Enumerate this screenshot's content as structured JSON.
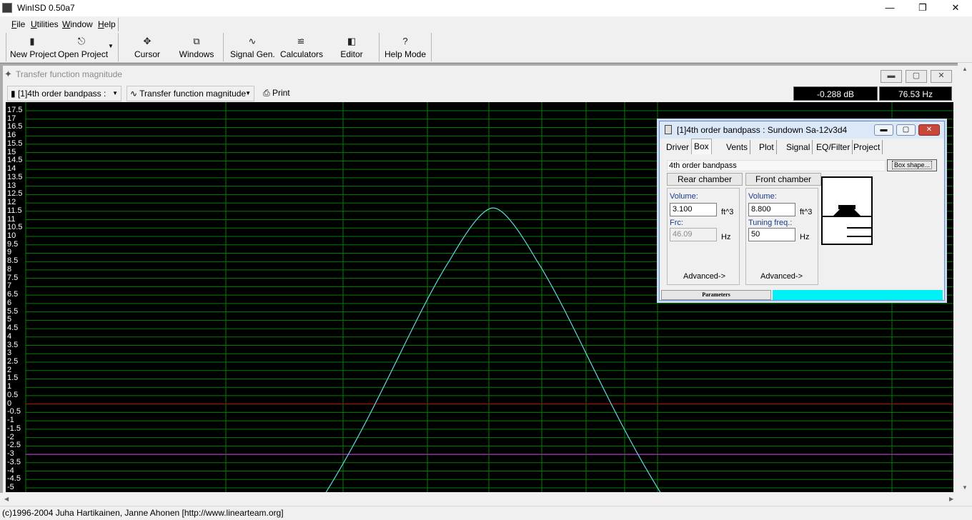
{
  "window": {
    "title": "WinISD 0.50a7"
  },
  "menu": [
    "File",
    "Utilities",
    "Window",
    "Help"
  ],
  "toolbar": {
    "new_project": "New Project",
    "open_project": "Open Project",
    "cursor": "Cursor",
    "windows": "Windows",
    "signal_gen": "Signal Gen.",
    "calculators": "Calculators",
    "editor": "Editor",
    "help_mode": "Help Mode"
  },
  "plot_window": {
    "title": "Transfer function magnitude",
    "project_selector": "[1]4th order bandpass :",
    "plot_selector": "Transfer function magnitude",
    "print": "Print",
    "readout_db": "-0.288 dB",
    "readout_hz": "76.53 Hz"
  },
  "chart_data": {
    "type": "line",
    "ylim": [
      -5,
      17.5
    ],
    "ytick_labels": [
      "17.5",
      "17",
      "16.5",
      "16",
      "15.5",
      "15",
      "14.5",
      "14",
      "13.5",
      "13",
      "12.5",
      "12",
      "11.5",
      "11",
      "10.5",
      "10",
      "9.5",
      "9",
      "8.5",
      "8",
      "7.5",
      "7",
      "6.5",
      "6",
      "5.5",
      "5",
      "4.5",
      "4",
      "3.5",
      "3",
      "2.5",
      "2",
      "1.5",
      "1",
      "0.5",
      "0",
      "-0.5",
      "-1",
      "-1.5",
      "-2",
      "-2.5",
      "-3",
      "-3.5",
      "-4",
      "-4.5",
      "-5"
    ],
    "grid": true,
    "reference_lines": [
      0,
      -3
    ],
    "peak_db": 11.7,
    "colors": {
      "background": "#000000",
      "grid": "#008000",
      "curve": "#5fd8e6",
      "zero_line": "#c00000",
      "minus3_line": "#9030a0"
    }
  },
  "dialog": {
    "title": "[1]4th order bandpass : Sundown Sa-12v3d4",
    "tabs": [
      "Driver",
      "Box",
      "Vents",
      "Plot",
      "Signal",
      "EQ/Filter",
      "Project"
    ],
    "active_tab": "Box",
    "box_type": "4th order bandpass",
    "box_shape_button": "Box shape...",
    "rear": {
      "header": "Rear chamber",
      "volume_label": "Volume:",
      "volume_value": "3.100",
      "volume_unit": "ft^3",
      "frc_label": "Frc:",
      "frc_value": "46.09",
      "frc_unit": "Hz",
      "advanced": "Advanced->"
    },
    "front": {
      "header": "Front chamber",
      "volume_label": "Volume:",
      "volume_value": "8.800",
      "volume_unit": "ft^3",
      "tuning_label": "Tuning freq.:",
      "tuning_value": "50",
      "tuning_unit": "Hz",
      "advanced": "Advanced->"
    },
    "status_label": "Parameters"
  },
  "status_bar": "(c)1996-2004 Juha Hartikainen, Janne Ahonen [http://www.linearteam.org]"
}
